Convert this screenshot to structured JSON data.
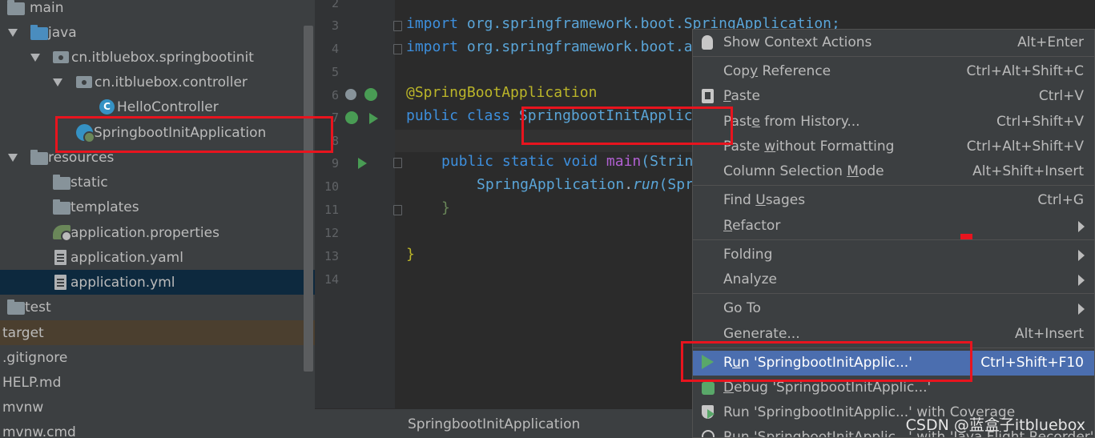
{
  "project_tree": {
    "items": [
      {
        "label": "main",
        "icon": "folder-icon"
      },
      {
        "label": "java",
        "icon": "source-folder-icon"
      },
      {
        "label": "cn.itbluebox.springbootinit",
        "icon": "package-icon"
      },
      {
        "label": "cn.itbluebox.controller",
        "icon": "package-icon"
      },
      {
        "label": "HelloController",
        "icon": "class-icon"
      },
      {
        "label": "SpringbootInitApplication",
        "icon": "spring-boot-app-icon"
      },
      {
        "label": "resources",
        "icon": "resources-folder-icon"
      },
      {
        "label": "static",
        "icon": "folder-icon"
      },
      {
        "label": "templates",
        "icon": "folder-icon"
      },
      {
        "label": "application.properties",
        "icon": "spring-config-icon"
      },
      {
        "label": "application.yaml",
        "icon": "file-icon"
      },
      {
        "label": "application.yml",
        "icon": "file-icon"
      },
      {
        "label": "test",
        "icon": "folder-icon"
      },
      {
        "label": "target",
        "icon": "none"
      },
      {
        "label": ".gitignore",
        "icon": "none"
      },
      {
        "label": "HELP.md",
        "icon": "none"
      },
      {
        "label": "mvnw",
        "icon": "none"
      },
      {
        "label": "mvnw.cmd",
        "icon": "none"
      }
    ],
    "class_icon_letter": "C"
  },
  "editor": {
    "line_numbers": [
      "2",
      "3",
      "4",
      "5",
      "6",
      "7",
      "8",
      "9",
      "10",
      "11",
      "12",
      "13",
      "14"
    ],
    "code": {
      "l3_kw": "import",
      "l3_rest": " org.springframework.boot.SpringApplication;",
      "l4_kw": "import",
      "l4_rest": " org.springframework.boot.a",
      "l6_annotation": "@SpringBootApplication",
      "l7_kw": "public class ",
      "l7_name": "SpringbootInitApplic",
      "l9_kw": "public static void ",
      "l9_fn": "main",
      "l9_rest": "(Strin",
      "l10_cls": "SpringApplication",
      "l10_dot": ".",
      "l10_fn": "run",
      "l10_rest": "(Spr",
      "l11_brace": "}",
      "l13_brace": "}"
    },
    "breadcrumb": "SpringbootInitApplication"
  },
  "context_menu": {
    "items": [
      {
        "pre": "",
        "u": "",
        "post": "Show Context Actions",
        "shortcut": "Alt+Enter",
        "icon": "lightbulb-icon"
      },
      {
        "pre": "Cop",
        "u": "y",
        "post": " Reference",
        "shortcut": "Ctrl+Alt+Shift+C",
        "icon": "none"
      },
      {
        "pre": "",
        "u": "P",
        "post": "aste",
        "shortcut": "Ctrl+V",
        "icon": "clipboard-icon"
      },
      {
        "pre": "Past",
        "u": "e",
        "post": " from History...",
        "shortcut": "Ctrl+Shift+V",
        "icon": "none"
      },
      {
        "pre": "Paste ",
        "u": "w",
        "post": "ithout Formatting",
        "shortcut": "Ctrl+Alt+Shift+V",
        "icon": "none"
      },
      {
        "pre": "Column Selection ",
        "u": "M",
        "post": "ode",
        "shortcut": "Alt+Shift+Insert",
        "icon": "none"
      },
      {
        "pre": "Find ",
        "u": "U",
        "post": "sages",
        "shortcut": "Ctrl+G",
        "icon": "none"
      },
      {
        "pre": "",
        "u": "R",
        "post": "efactor",
        "shortcut": "",
        "icon": "none"
      },
      {
        "pre": "Folding",
        "u": "",
        "post": "",
        "shortcut": "",
        "icon": "none"
      },
      {
        "pre": "Analyze",
        "u": "",
        "post": "",
        "shortcut": "",
        "icon": "none"
      },
      {
        "pre": "Go To",
        "u": "",
        "post": "",
        "shortcut": "",
        "icon": "none"
      },
      {
        "pre": "Generate...",
        "u": "",
        "post": "",
        "shortcut": "Alt+Insert",
        "icon": "none"
      },
      {
        "pre": "R",
        "u": "u",
        "post": "n 'SpringbootInitApplic...'",
        "shortcut": "Ctrl+Shift+F10",
        "icon": "run-icon"
      },
      {
        "pre": "",
        "u": "D",
        "post": "ebug 'SpringbootInitApplic...'",
        "shortcut": "",
        "icon": "debug-icon"
      },
      {
        "pre": "Run 'SpringbootInitApplic...' with Coverage",
        "u": "",
        "post": "",
        "shortcut": "",
        "icon": "coverage-icon"
      },
      {
        "pre": "Run 'SpringbootInitApplic...' with 'Java Flight Recorder'",
        "u": "",
        "post": "",
        "shortcut": "",
        "icon": "profiler-icon"
      }
    ]
  },
  "watermark": "CSDN @蓝盒子itbluebox",
  "colors": {
    "annotation_red": "#e8141e",
    "menu_highlight": "#4b6eaf",
    "tree_selection": "#0d293e",
    "run_green": "#59a869"
  }
}
